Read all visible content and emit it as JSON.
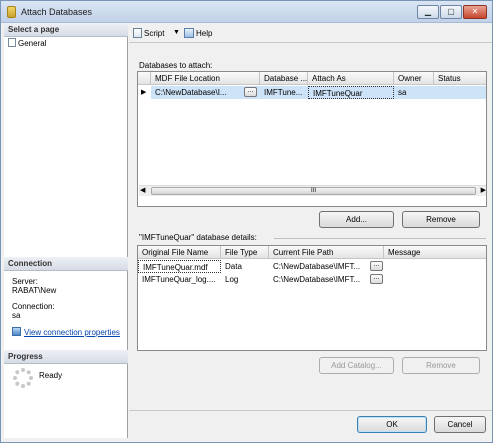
{
  "window": {
    "title": "Attach Databases",
    "min": "▁",
    "max": "▢",
    "close": "✕"
  },
  "left": {
    "select_page_header": "Select a page",
    "pages": [
      "General"
    ],
    "connection_header": "Connection",
    "server_label": "Server:",
    "server_value": "RABAT\\New",
    "connection_label": "Connection:",
    "connection_value": "sa",
    "view_link": "View connection properties",
    "progress_header": "Progress",
    "progress_status": "Ready"
  },
  "toolbar": {
    "script": "Script",
    "help": "Help"
  },
  "attach": {
    "label": "Databases to attach:",
    "columns": [
      "MDF File Location",
      "Database ...",
      "Attach As",
      "Owner",
      "Status"
    ],
    "rows": [
      {
        "mdf": "C:\\NewDatabase\\I...",
        "database": "IMFTune...",
        "attach_as": "IMFTuneQuar",
        "owner": "sa",
        "status": ""
      }
    ],
    "browse": "...",
    "scroll_thumb": "III",
    "add": "Add...",
    "remove": "Remove"
  },
  "details": {
    "label": "\"IMFTuneQuar\" database details:",
    "columns": [
      "Original File Name",
      "File Type",
      "Current File Path",
      "Message"
    ],
    "rows": [
      {
        "name": "IMFTuneQuar.mdf",
        "type": "Data",
        "path": "C:\\NewDatabase\\IMFT...",
        "message": ""
      },
      {
        "name": "IMFTuneQuar_log....",
        "type": "Log",
        "path": "C:\\NewDatabase\\IMFT...",
        "message": ""
      }
    ],
    "browse": "...",
    "add_catalog": "Add Catalog...",
    "remove": "Remove"
  },
  "footer": {
    "ok": "OK",
    "cancel": "Cancel"
  }
}
